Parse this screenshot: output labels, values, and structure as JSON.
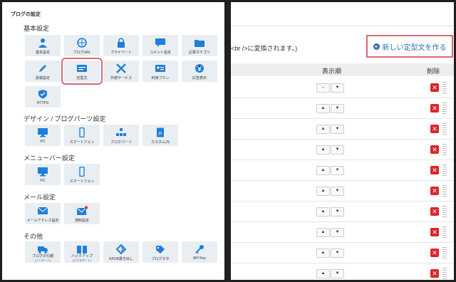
{
  "left": {
    "title": "ブログの設定",
    "sections": [
      {
        "heading": "基本設定",
        "tiles": [
          {
            "label": "基本設定",
            "icon": "user-icon"
          },
          {
            "label": "ブログURL",
            "icon": "globe-icon"
          },
          {
            "label": "プライベート",
            "icon": "lock-icon"
          },
          {
            "label": "コメント設定",
            "icon": "comment-icon"
          },
          {
            "label": "記事カテゴリ",
            "icon": "folder-icon"
          },
          {
            "label": "投稿設定",
            "icon": "pencil-icon"
          },
          {
            "label": "定型文",
            "icon": "template-icon"
          },
          {
            "label": "外部サービス",
            "icon": "cross-tools-icon"
          },
          {
            "label": "利用プラン",
            "icon": "id-card-icon"
          },
          {
            "label": "広告表示",
            "icon": "yen-icon"
          },
          {
            "label": "HTTPS",
            "icon": "shield-icon"
          }
        ]
      },
      {
        "heading": "デザイン / ブログパーツ設定",
        "tiles": [
          {
            "label": "PC",
            "icon": "monitor-icon"
          },
          {
            "label": "スマートフォン",
            "icon": "smartphone-icon"
          },
          {
            "label": "ブログパーツ",
            "icon": "blocks-icon"
          },
          {
            "label": "カスタムJS",
            "icon": "js-file-icon"
          }
        ]
      },
      {
        "heading": "メニューバー設定",
        "tiles": [
          {
            "label": "PC",
            "icon": "monitor-icon"
          },
          {
            "label": "スマートフォン",
            "icon": "smartphone-icon"
          }
        ]
      },
      {
        "heading": "メール設定",
        "tiles": [
          {
            "label": "メールアドレス設定",
            "icon": "mail-icon"
          },
          {
            "label": "通知設定",
            "icon": "mail-notify-icon"
          }
        ]
      },
      {
        "heading": "その他",
        "tiles": [
          {
            "label": "ブログの引越",
            "sub": "(インポート)",
            "icon": "truck-icon"
          },
          {
            "label": "バックアップ",
            "sub": "(エクスポート)",
            "icon": "book-icon"
          },
          {
            "label": "EPUB書き出し",
            "icon": "epub-icon"
          },
          {
            "label": "ブログネタ",
            "icon": "tag-icon"
          },
          {
            "label": "API Key",
            "icon": "key-icon"
          }
        ]
      }
    ]
  },
  "right": {
    "note": "<br />に変換されます。)",
    "new_button": "新しい定型文を作る",
    "col_order": "表示順",
    "col_delete": "削除",
    "up": "▲",
    "down": "▼",
    "delete_mark": "✕",
    "rows": 10
  },
  "colors": {
    "accent": "#2f6fb0",
    "highlight": "#d96a72",
    "delete": "#d9262b",
    "tile_bg": "#e9eef3",
    "icon_blue": "#1f7fd6"
  }
}
